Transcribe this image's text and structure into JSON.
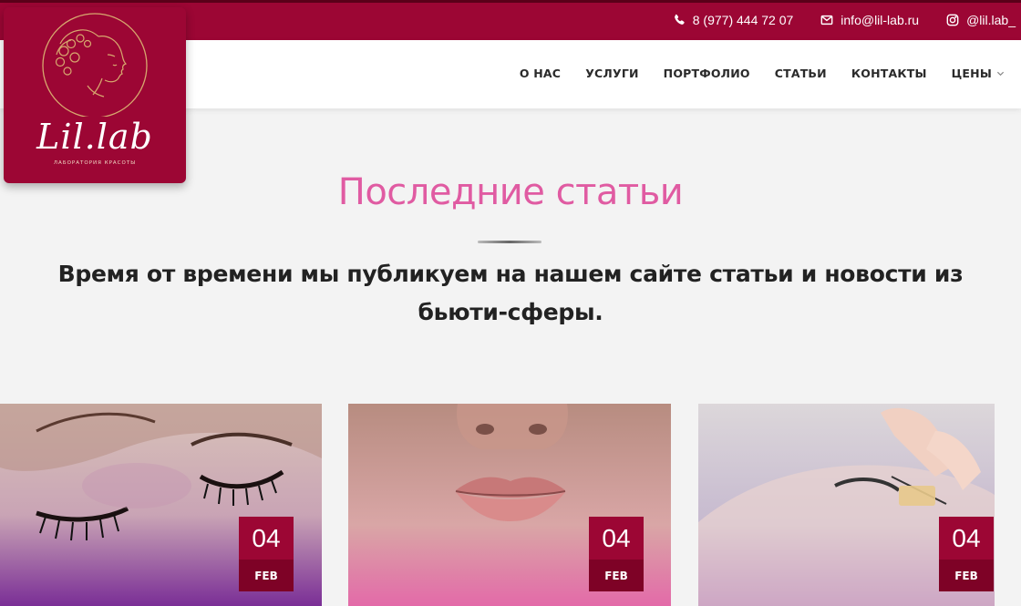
{
  "topbar": {
    "phone": "8 (977) 444 72 07",
    "email": "info@lil-lab.ru",
    "instagram": "@lil.lab_"
  },
  "logo": {
    "brand": "Lil.lab",
    "tagline": "ЛАБОРАТОРИЯ КРАСОТЫ"
  },
  "nav": {
    "items": [
      "О НАС",
      "УСЛУГИ",
      "ПОРТФОЛИО",
      "СТАТЬИ",
      "КОНТАКТЫ",
      "ЦЕНЫ"
    ]
  },
  "section": {
    "title": "Последние статьи",
    "subtitle_line1": "Время от времени мы публикуем на нашем сайте статьи и новости из",
    "subtitle_line2": "бьюти-сферы."
  },
  "articles": [
    {
      "day": "04",
      "month": "FEB"
    },
    {
      "day": "04",
      "month": "FEB"
    },
    {
      "day": "04",
      "month": "FEB"
    }
  ],
  "colors": {
    "brand": "#9c0634",
    "title_pink": "#e05ba2"
  }
}
